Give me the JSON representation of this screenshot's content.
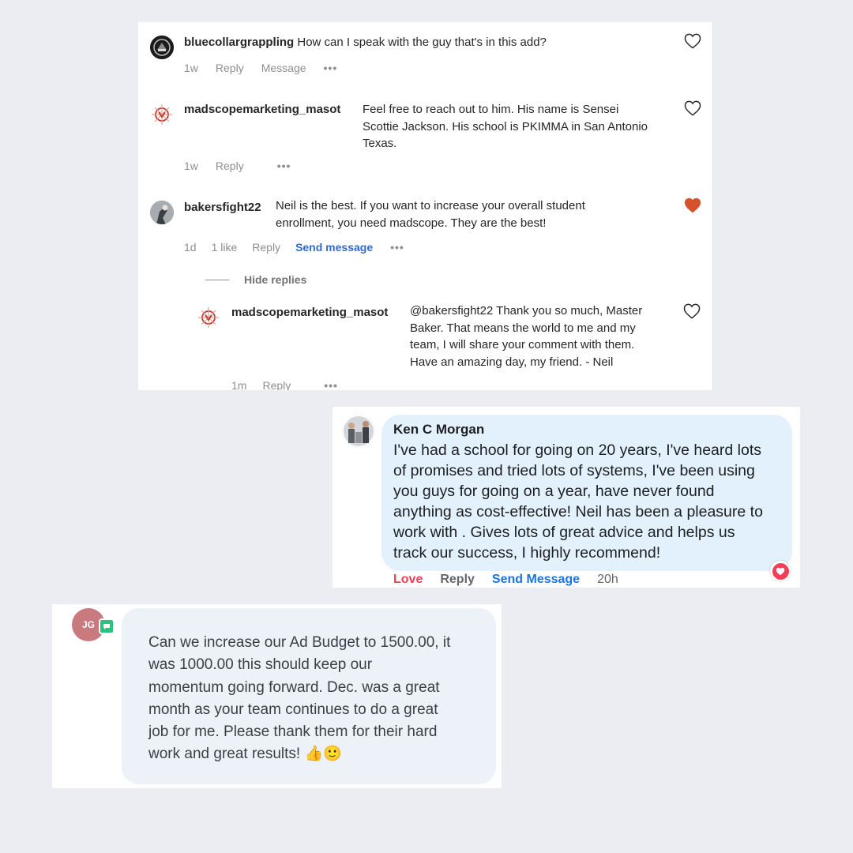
{
  "instagram": {
    "comments": [
      {
        "username": "bluecollargrappling",
        "text": "How can I speak with the guy that's in this add?",
        "time": "1w",
        "reply": "Reply",
        "message": "Message",
        "more": "•••",
        "liked": false
      },
      {
        "username": "madscopemarketing_masot",
        "lines": [
          "Feel free to reach out to him. His name is Sensei",
          "Scottie Jackson. His school is PKIMMA in San Antonio",
          "Texas."
        ],
        "time": "1w",
        "reply": "Reply",
        "more": "•••",
        "liked": false
      },
      {
        "username": "bakersfight22",
        "lines": [
          "Neil is the best. If you want to increase your overall student",
          "enrollment, you need madscope. They are the best!"
        ],
        "time": "1d",
        "likes": "1 like",
        "reply": "Reply",
        "send_message": "Send message",
        "more": "•••",
        "liked": true
      }
    ],
    "hide_replies": "Hide replies",
    "reply_comment": {
      "username": "madscopemarketing_masot",
      "lines": [
        "@bakersfight22 Thank you so much, Master",
        "Baker. That means the world to me and my",
        "team, I will share your comment with them.",
        "Have an amazing day, my friend. - Neil"
      ],
      "time": "1m",
      "reply": "Reply",
      "more": "•••",
      "liked": false
    },
    "colors": {
      "heart_filled": "#d5522c",
      "link": "#3069d6"
    }
  },
  "facebook": {
    "name": "Ken C Morgan",
    "lines": [
      "I've had a school for going on 20 years, I've heard lots",
      "of promises and tried lots of systems,  I've been using",
      "you guys for going on a year, have never found",
      "anything as cost-effective! Neil has been a pleasure to",
      "work with  . Gives lots of great advice and helps us",
      "track our success, I highly recommend!"
    ],
    "love": "Love",
    "reply": "Reply",
    "send_message": "Send Message",
    "time": "20h",
    "reaction_icon": "heart-icon"
  },
  "chat": {
    "avatar_initials": "JG",
    "lines": [
      "Can we increase our Ad Budget to 1500.00, it",
      "was 1000.00 this should keep our",
      "momentum going forward. Dec. was a great",
      "month as your team continues to do a great",
      "job for me. Please thank them for  their hard",
      "work and great results! 👍🙂"
    ]
  }
}
